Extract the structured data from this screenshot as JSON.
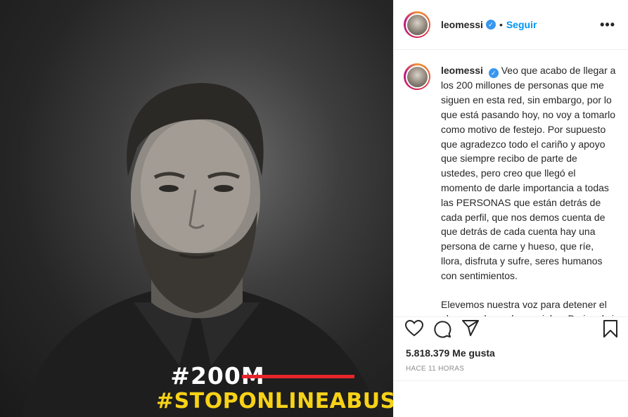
{
  "post": {
    "image_tag_old": "#200M",
    "image_tag_new": "#STOPONLINEABUSE"
  },
  "header": {
    "username": "leomessi",
    "verified_icon": "verified-badge-icon",
    "separator": "•",
    "follow_label": "Seguir",
    "more_icon": "more-options-icon",
    "more_glyph": "•••"
  },
  "caption": {
    "username": "leomessi",
    "paragraph1": "Veo que acabo de llegar a los 200 millones de personas que me siguen en esta red, sin embargo, por lo que está pasando hoy, no voy a tomarlo como motivo de festejo. Por supuesto que agradezco todo el cariño y apoyo que siempre recibo de parte de ustedes, pero creo que llegó el momento de darle importancia a todas las PERSONAS que están detrás de cada perfil, que nos demos cuenta de que detrás de cada cuenta hay una persona de carne y hueso, que ríe, llora, disfruta y sufre, seres humanos con sentimientos.",
    "paragraph2": "Elevemos nuestra voz para detener el abuso en las redes sociales. Da igual si somos anónimos, famosos, deportistas, músicos, conocidos o desconocidos."
  },
  "actions": {
    "like_icon": "heart-icon",
    "comment_icon": "comment-icon",
    "share_icon": "share-icon",
    "save_icon": "bookmark-icon"
  },
  "stats": {
    "likes": "5.818.379 Me gusta",
    "time": "HACE 11 HORAS"
  },
  "colors": {
    "accent": "#0095f6",
    "verified": "#3897f0",
    "tag_strike": "#e8252b",
    "tag_yellow": "#f7d217"
  }
}
